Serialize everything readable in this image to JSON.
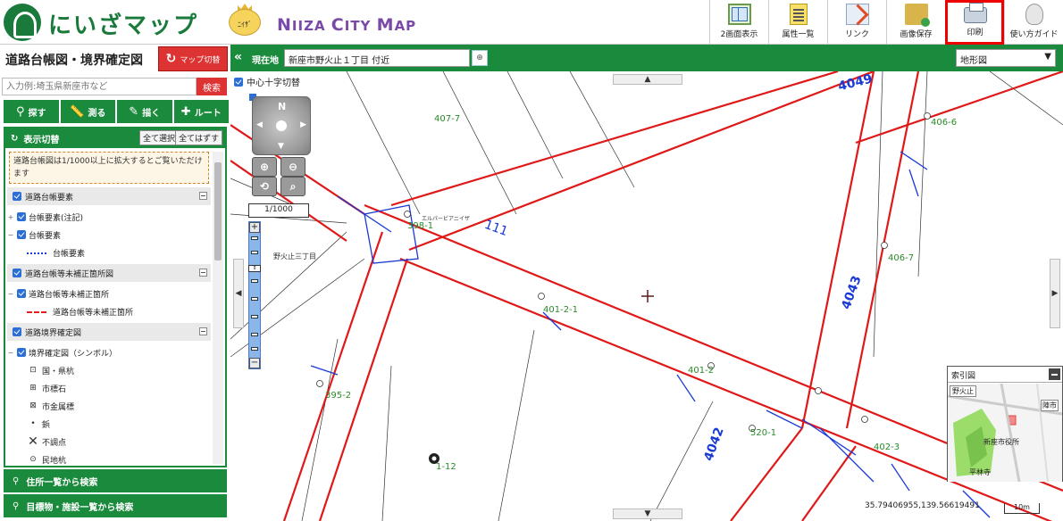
{
  "header": {
    "logo_text": "にいざマップ",
    "mascot_text": "ﾆｲｻﾞ",
    "city_title_first": "N",
    "city_title_rest_1": "IIZA ",
    "city_title_big": "C",
    "city_title_rest_2": "ITY ",
    "city_title_big2": "M",
    "city_title_rest_3": "AP",
    "toolbar": [
      {
        "label": "2画面表示",
        "icon": "two-screen-icon"
      },
      {
        "label": "属性一覧",
        "icon": "attribute-list-icon"
      },
      {
        "label": "リンク",
        "icon": "link-icon"
      },
      {
        "label": "画像保存",
        "icon": "save-image-icon"
      },
      {
        "label": "印刷",
        "icon": "print-icon",
        "active": true
      },
      {
        "label": "使い方ガイド",
        "icon": "guide-icon"
      }
    ]
  },
  "left_panel": {
    "title": "道路台帳図・境界確定図",
    "map_switch": "マップ切替",
    "search_placeholder": "入力例:埼玉県新座市など",
    "search_button": "検索",
    "tools": [
      {
        "label": "探す",
        "icon": "search-icon"
      },
      {
        "label": "測る",
        "icon": "ruler-icon"
      },
      {
        "label": "描く",
        "icon": "draw-icon"
      },
      {
        "label": "ルート",
        "icon": "route-icon"
      }
    ],
    "display_header": "表示切替",
    "select_all": "全て選択",
    "deselect_all": "全てはずす",
    "notice": "道路台帳図は1/1000以上に拡大するとご覧いただけます",
    "groups": [
      {
        "title": "道路台帳要素",
        "items": [
          {
            "label": "台帳要素(注記)",
            "expander": "+"
          },
          {
            "label": "台帳要素",
            "expander": "−"
          },
          {
            "label": "台帳要素",
            "symbol": "line"
          }
        ]
      },
      {
        "title": "道路台帳等未補正箇所図",
        "items": [
          {
            "label": "道路台帳等未補正箇所",
            "expander": "−"
          },
          {
            "label": "道路台帳等未補正箇所",
            "symbol": "redline"
          }
        ]
      },
      {
        "title": "道路境界確定図",
        "items": [
          {
            "label": "境界確定図（シンボル）",
            "expander": "−"
          },
          {
            "label": "国・県杭",
            "symbol": "⊡"
          },
          {
            "label": "市標石",
            "symbol": "⊞"
          },
          {
            "label": "市金属標",
            "symbol": "⊠"
          },
          {
            "label": "鋲",
            "symbol": "•"
          },
          {
            "label": "不調点",
            "symbol": "✕"
          },
          {
            "label": "民地杭",
            "symbol": "⊙"
          }
        ]
      }
    ],
    "bottom_buttons": [
      {
        "label": "住所一覧から検索"
      },
      {
        "label": "目標物・施設一覧から検索"
      }
    ]
  },
  "map": {
    "location_label": "現在地",
    "location_value": "新座市野火止１丁目 付近",
    "basemap": "地形図",
    "crosshair_toggle": "中心十字切替",
    "north": "N",
    "scale": "1/1000",
    "coordinates": "35.79406955,139.56619491",
    "scalebar": "10m",
    "overview": {
      "title": "索引図",
      "labels": [
        "野火止",
        "新座市役所",
        "平林寺",
        "陣市"
      ]
    },
    "labels": [
      {
        "text": "4049",
        "color": "#1a3ad6"
      },
      {
        "text": "4043",
        "color": "#1a3ad6"
      },
      {
        "text": "4042",
        "color": "#1a3ad6"
      },
      {
        "text": "111",
        "color": "#1a3ad6"
      },
      {
        "text": "407-7",
        "color": "#2a8a2a"
      },
      {
        "text": "406-6",
        "color": "#2a8a2a"
      },
      {
        "text": "406-7",
        "color": "#2a8a2a"
      },
      {
        "text": "398-1",
        "color": "#2a8a2a"
      },
      {
        "text": "401-2",
        "color": "#2a8a2a"
      },
      {
        "text": "401-2-1",
        "color": "#2a8a2a"
      },
      {
        "text": "395-2",
        "color": "#2a8a2a"
      },
      {
        "text": "520-1",
        "color": "#2a8a2a"
      },
      {
        "text": "402-3",
        "color": "#2a8a2a"
      },
      {
        "text": "1-12",
        "color": "#2a8a2a"
      },
      {
        "text": "野火止三丁目",
        "color": "#333333"
      },
      {
        "text": "エルパービアニイザ",
        "color": "#333333"
      }
    ]
  }
}
